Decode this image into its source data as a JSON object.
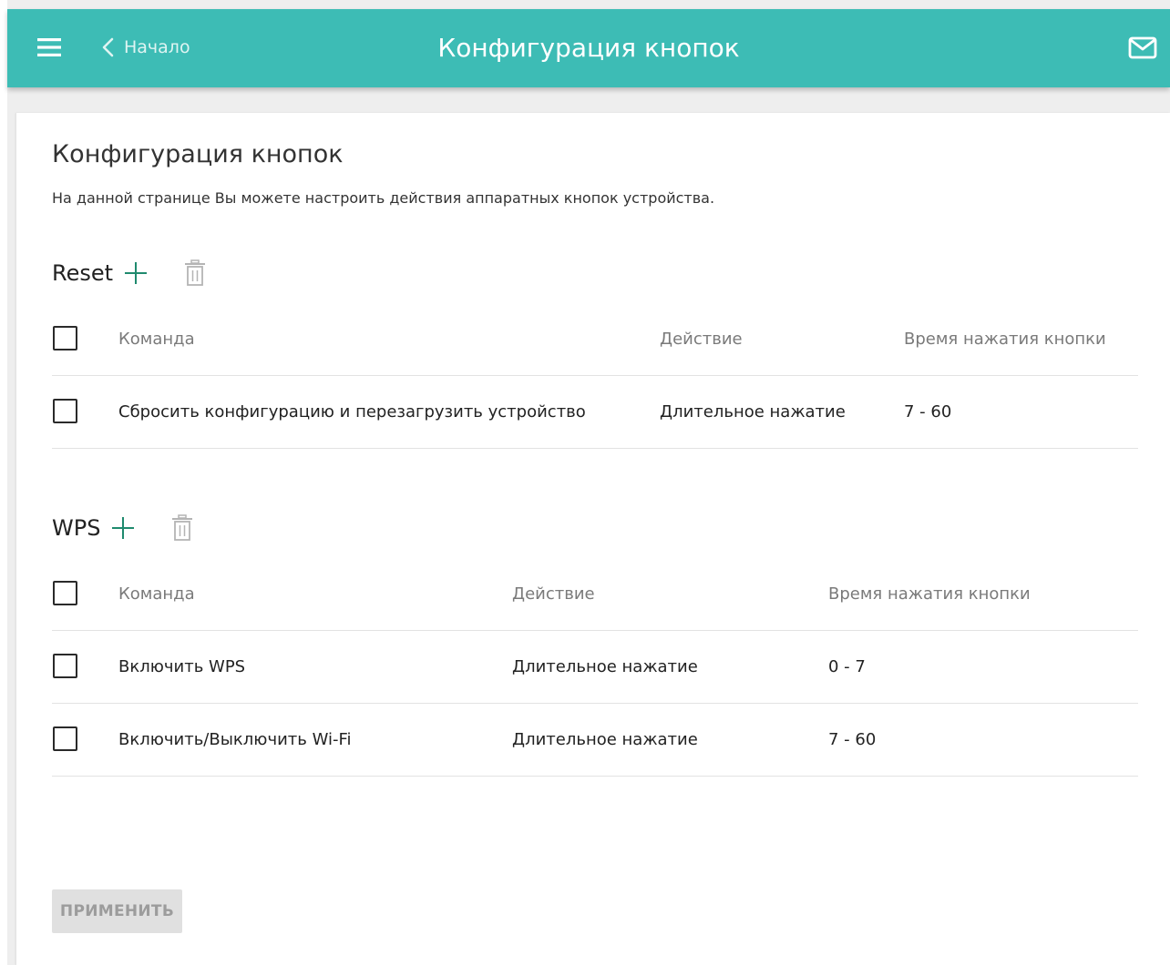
{
  "header": {
    "back_label": "Начало",
    "title": "Конфигурация кнопок",
    "color": "#3dbcb5"
  },
  "page": {
    "title": "Конфигурация кнопок",
    "description": "На данной странице Вы можете настроить действия аппаратных кнопок устройства."
  },
  "sections": [
    {
      "name": "Reset",
      "columns": [
        "Команда",
        "Действие",
        "Время нажатия кнопки"
      ],
      "rows": [
        {
          "command": "Сбросить конфигурацию и перезагрузить устройство",
          "action": "Длительное нажатие",
          "time": "7 - 60",
          "checked": false
        }
      ]
    },
    {
      "name": "WPS",
      "columns": [
        "Команда",
        "Действие",
        "Время нажатия кнопки"
      ],
      "rows": [
        {
          "command": "Включить WPS",
          "action": "Длительное нажатие",
          "time": "0 - 7",
          "checked": false
        },
        {
          "command": "Включить/Выключить Wi-Fi",
          "action": "Длительное нажатие",
          "time": "7 - 60",
          "checked": false
        }
      ]
    }
  ],
  "apply_label": "ПРИМЕНИТЬ",
  "icons": {
    "menu": "hamburger-menu-icon",
    "back": "chevron-left-icon",
    "mail": "mail-envelope-icon",
    "add": "plus-icon",
    "delete": "trash-icon"
  }
}
